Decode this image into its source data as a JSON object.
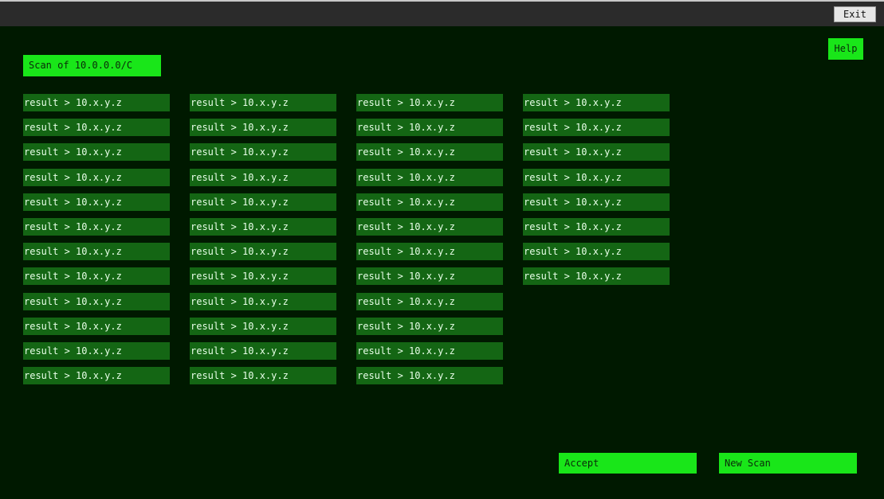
{
  "window": {
    "exit_label": "Exit"
  },
  "help_label": "Help",
  "scan_title": "Scan of 10.0.0.0/C",
  "results": {
    "columns": [
      [
        "result > 10.x.y.z",
        "result > 10.x.y.z",
        "result > 10.x.y.z",
        "result > 10.x.y.z",
        "result > 10.x.y.z",
        "result > 10.x.y.z",
        "result > 10.x.y.z",
        "result > 10.x.y.z",
        "result > 10.x.y.z",
        "result > 10.x.y.z",
        "result > 10.x.y.z",
        "result > 10.x.y.z"
      ],
      [
        "result > 10.x.y.z",
        "result > 10.x.y.z",
        "result > 10.x.y.z",
        "result > 10.x.y.z",
        "result > 10.x.y.z",
        "result > 10.x.y.z",
        "result > 10.x.y.z",
        "result > 10.x.y.z",
        "result > 10.x.y.z",
        "result > 10.x.y.z",
        "result > 10.x.y.z",
        "result > 10.x.y.z"
      ],
      [
        "result > 10.x.y.z",
        "result > 10.x.y.z",
        "result > 10.x.y.z",
        "result > 10.x.y.z",
        "result > 10.x.y.z",
        "result > 10.x.y.z",
        "result > 10.x.y.z",
        "result > 10.x.y.z",
        "result > 10.x.y.z",
        "result > 10.x.y.z",
        "result > 10.x.y.z",
        "result > 10.x.y.z"
      ],
      [
        "result > 10.x.y.z",
        "result > 10.x.y.z",
        "result > 10.x.y.z",
        "result > 10.x.y.z",
        "result > 10.x.y.z",
        "result > 10.x.y.z",
        "result > 10.x.y.z",
        "result > 10.x.y.z"
      ]
    ]
  },
  "actions": {
    "accept_label": "Accept",
    "new_scan_label": "New Scan"
  },
  "colors": {
    "background": "#001900",
    "accent": "#19e619",
    "result_bg": "#146614"
  }
}
